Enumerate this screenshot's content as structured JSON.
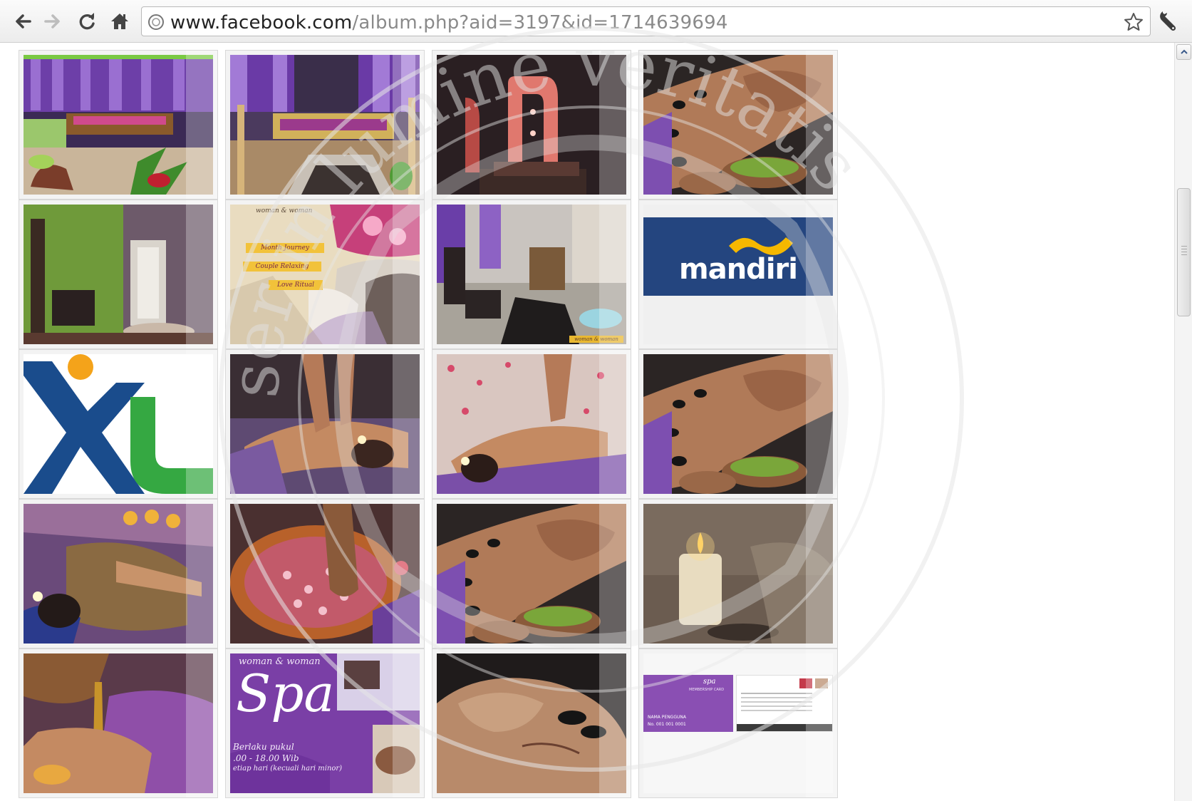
{
  "browser": {
    "url_host": "www.facebook.com",
    "url_path": "/album.php?aid=3197&id=1714639694"
  },
  "icons": {
    "back": "back-arrow-icon",
    "forward": "forward-arrow-icon",
    "reload": "reload-icon",
    "home": "home-icon",
    "page": "page-globe-icon",
    "bookmark": "star-icon",
    "settings": "wrench-icon",
    "scroll_up": "chevron-up-icon"
  },
  "album": {
    "photos": [
      {
        "subject": "purple-curtain-lounge"
      },
      {
        "subject": "spa-bed-room"
      },
      {
        "subject": "red-glowing-sculpture"
      },
      {
        "subject": "hot-stone-massage"
      },
      {
        "subject": "green-wall-bath-room"
      },
      {
        "subject": "spa-promo-flyer",
        "text": [
          "woman & woman",
          "Month Journey",
          "Couple Relaxing",
          "Love Ritual"
        ]
      },
      {
        "subject": "salon-interior",
        "text": [
          "woman & woman"
        ]
      },
      {
        "subject": "mandiri-logo",
        "text": [
          "mandiri"
        ]
      },
      {
        "subject": "xl-logo"
      },
      {
        "subject": "back-massage"
      },
      {
        "subject": "flower-massage"
      },
      {
        "subject": "hot-stone-massage"
      },
      {
        "subject": "scrub-massage"
      },
      {
        "subject": "flower-foot-bath"
      },
      {
        "subject": "hot-stone-massage"
      },
      {
        "subject": "candle"
      },
      {
        "subject": "oil-pouring"
      },
      {
        "subject": "spa-poster",
        "text": [
          "woman & woman",
          "Spa",
          "Berlaku pukul",
          ".00 - 18.00 Wib",
          "etiap hari (kecuali hari minor)"
        ]
      },
      {
        "subject": "face-stones"
      },
      {
        "subject": "membership-card",
        "text": [
          "spa",
          "MEMBERSHIP CARD",
          "NAMA PENGGUNA",
          "No. 001 001 0001"
        ]
      }
    ]
  },
  "watermark": {
    "text": "ser in lumine veritatis"
  },
  "colors": {
    "purple": "#7b4fb0",
    "mandiri_blue": "#24457f",
    "mandiri_gold": "#f5b800",
    "xl_blue": "#1a4c8c",
    "xl_green": "#35a842",
    "xl_orange": "#f4a31a"
  }
}
